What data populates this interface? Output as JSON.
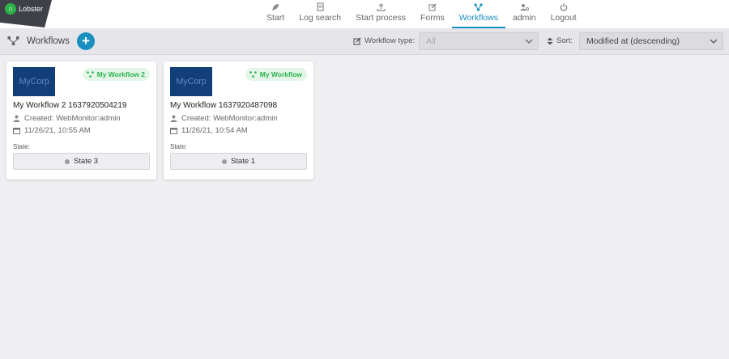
{
  "logo": {
    "text": "Lobster"
  },
  "nav": [
    {
      "label": "Start",
      "icon": "rocket-icon"
    },
    {
      "label": "Log search",
      "icon": "document-icon"
    },
    {
      "label": "Start process",
      "icon": "upload-icon"
    },
    {
      "label": "Forms",
      "icon": "edit-icon"
    },
    {
      "label": "Workflows",
      "icon": "workflow-icon",
      "active": true
    },
    {
      "label": "admin",
      "icon": "user-gear-icon"
    },
    {
      "label": "Logout",
      "icon": "power-icon"
    }
  ],
  "toolbar": {
    "title": "Workflows",
    "add_label": "+",
    "workflow_type_label": "Workflow type:",
    "workflow_type_value": "All",
    "sort_label": "Sort:",
    "sort_value": "Modified at (descending)"
  },
  "cards": [
    {
      "logo_text": "MyCorp",
      "badge": "My Workflow 2",
      "title": "My Workflow 2 1637920504219",
      "created": "Created: WebMonitor:admin",
      "date": "11/26/21, 10:55 AM",
      "state_label": "State:",
      "state": "State 3"
    },
    {
      "logo_text": "MyCorp",
      "badge": "My Workflow",
      "title": "My Workflow 1637920487098",
      "created": "Created: WebMonitor:admin",
      "date": "11/26/21, 10:54 AM",
      "state_label": "State:",
      "state": "State 1"
    }
  ],
  "colors": {
    "accent": "#1b8fc0",
    "badge_green": "#2bb24c",
    "corp_blue": "#123f7a"
  }
}
